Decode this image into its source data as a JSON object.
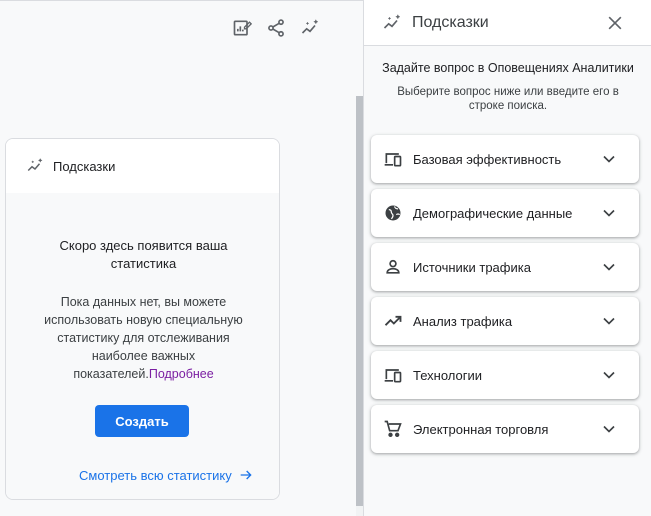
{
  "left": {
    "toolbar": {
      "icons": [
        "edit-report-icon",
        "share-icon",
        "insights-icon"
      ]
    },
    "card": {
      "title": "Подсказки",
      "empty_title": "Скоро здесь появится ваша статистика",
      "empty_desc": "Пока данных нет, вы можете использовать новую специальную статистику для отслеживания наиболее важных показателей.",
      "learn_more": "Подробнее",
      "create_label": "Создать",
      "see_all_label": "Смотреть всю статистику"
    }
  },
  "panel": {
    "title": "Подсказки",
    "ask_title": "Задайте вопрос в Оповещениях Аналитики",
    "ask_sub": "Выберите вопрос ниже или введите его в строке поиска.",
    "items": [
      {
        "label": "Базовая эффективность",
        "icon": "devices-icon"
      },
      {
        "label": "Демографические данные",
        "icon": "globe-icon"
      },
      {
        "label": "Источники трафика",
        "icon": "person-icon"
      },
      {
        "label": "Анализ трафика",
        "icon": "trending-up-icon"
      },
      {
        "label": "Технологии",
        "icon": "devices-icon"
      },
      {
        "label": "Электронная торговля",
        "icon": "cart-icon"
      }
    ]
  },
  "colors": {
    "accent": "#1a73e8",
    "link": "#7b1fa2",
    "icon": "#5f6368"
  }
}
